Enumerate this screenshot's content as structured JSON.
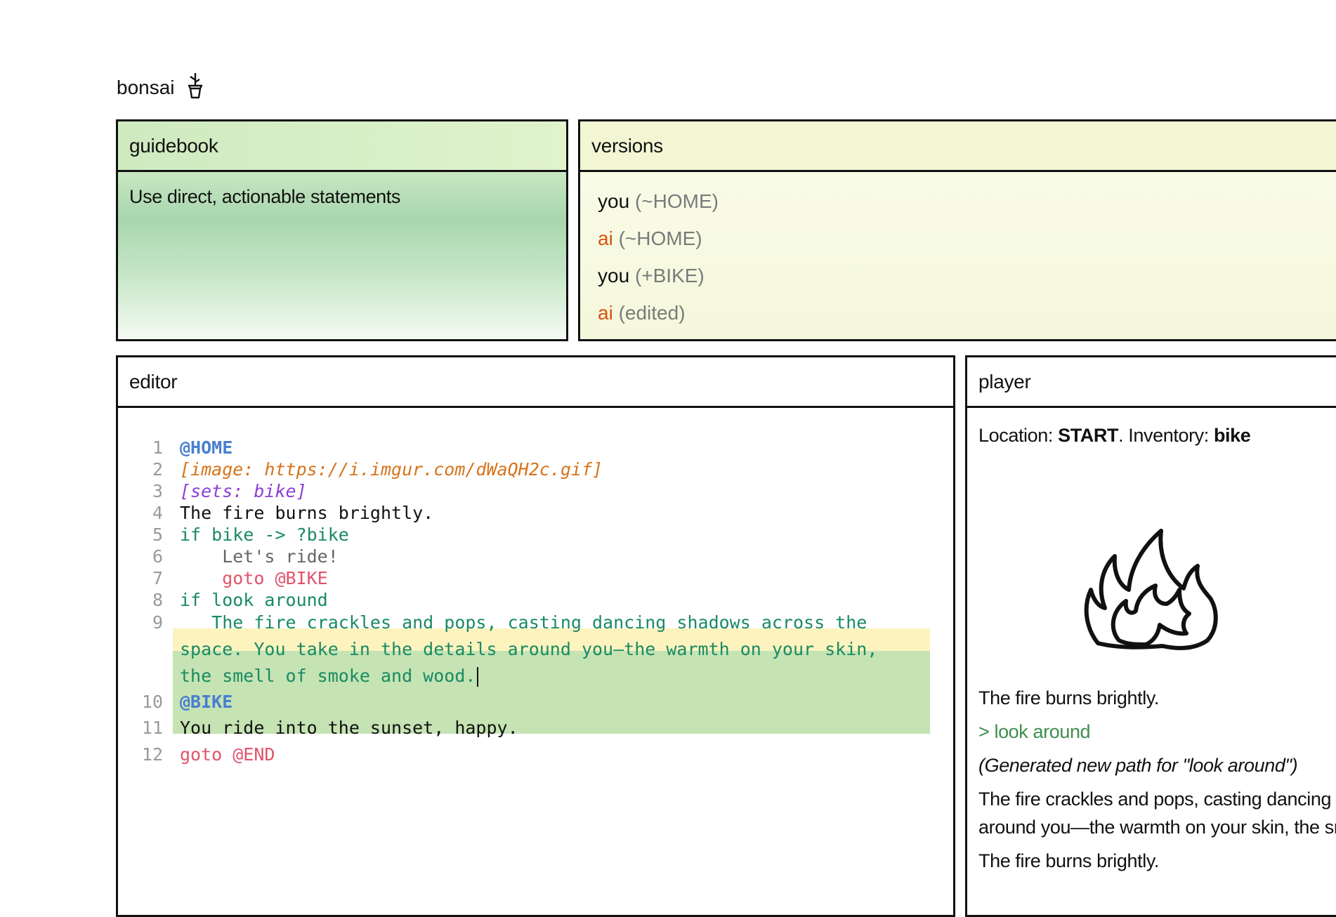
{
  "app": {
    "title": "bonsai",
    "logo_icon": "bonsai-pot-icon"
  },
  "guidebook": {
    "title": "guidebook",
    "text": "Use direct, actionable statements"
  },
  "versions": {
    "title": "versions",
    "items": [
      {
        "author": "you",
        "tag": "(~HOME)"
      },
      {
        "author": "ai",
        "tag": "(~HOME)"
      },
      {
        "author": "you",
        "tag": "(+BIKE)"
      },
      {
        "author": "ai",
        "tag": "(edited)"
      }
    ]
  },
  "editor": {
    "title": "editor",
    "lines": [
      {
        "n": "1",
        "text": "@HOME"
      },
      {
        "n": "2",
        "text": "[image: https://i.imgur.com/dWaQH2c.gif]"
      },
      {
        "n": "3",
        "text": "[sets: bike]"
      },
      {
        "n": "4",
        "text": "The fire burns brightly."
      },
      {
        "n": "5",
        "text": "if bike -> ?bike"
      },
      {
        "n": "6",
        "text": "    Let's ride!"
      },
      {
        "n": "7",
        "text": "    goto @BIKE"
      },
      {
        "n": "8",
        "text": "if look around"
      },
      {
        "n": "9",
        "text": "   The fire crackles and pops, casting dancing shadows across the"
      },
      {
        "n": "",
        "text": "space. You take in the details around you—the warmth on your skin,"
      },
      {
        "n": "",
        "text": "the smell of smoke and wood."
      },
      {
        "n": "10",
        "text": "@BIKE"
      },
      {
        "n": "11",
        "text": "You ride into the sunset, happy."
      },
      {
        "n": "12",
        "text": "goto @END"
      }
    ]
  },
  "player": {
    "title": "player",
    "location_label": "Location:",
    "location_value": "START",
    "inventory_label": "Inventory:",
    "inventory_value": "bike",
    "image_icon": "fire-icon",
    "para1": "The fire burns brightly.",
    "action": "> look around",
    "generated": "(Generated new path for \"look around\")",
    "para2a": "The fire crackles and pops, casting dancing shadows across the space. You take in the details",
    "para2b": "around you—the warmth on your skin, the smell of smoke and wood.",
    "para3": "The fire burns brightly."
  }
}
